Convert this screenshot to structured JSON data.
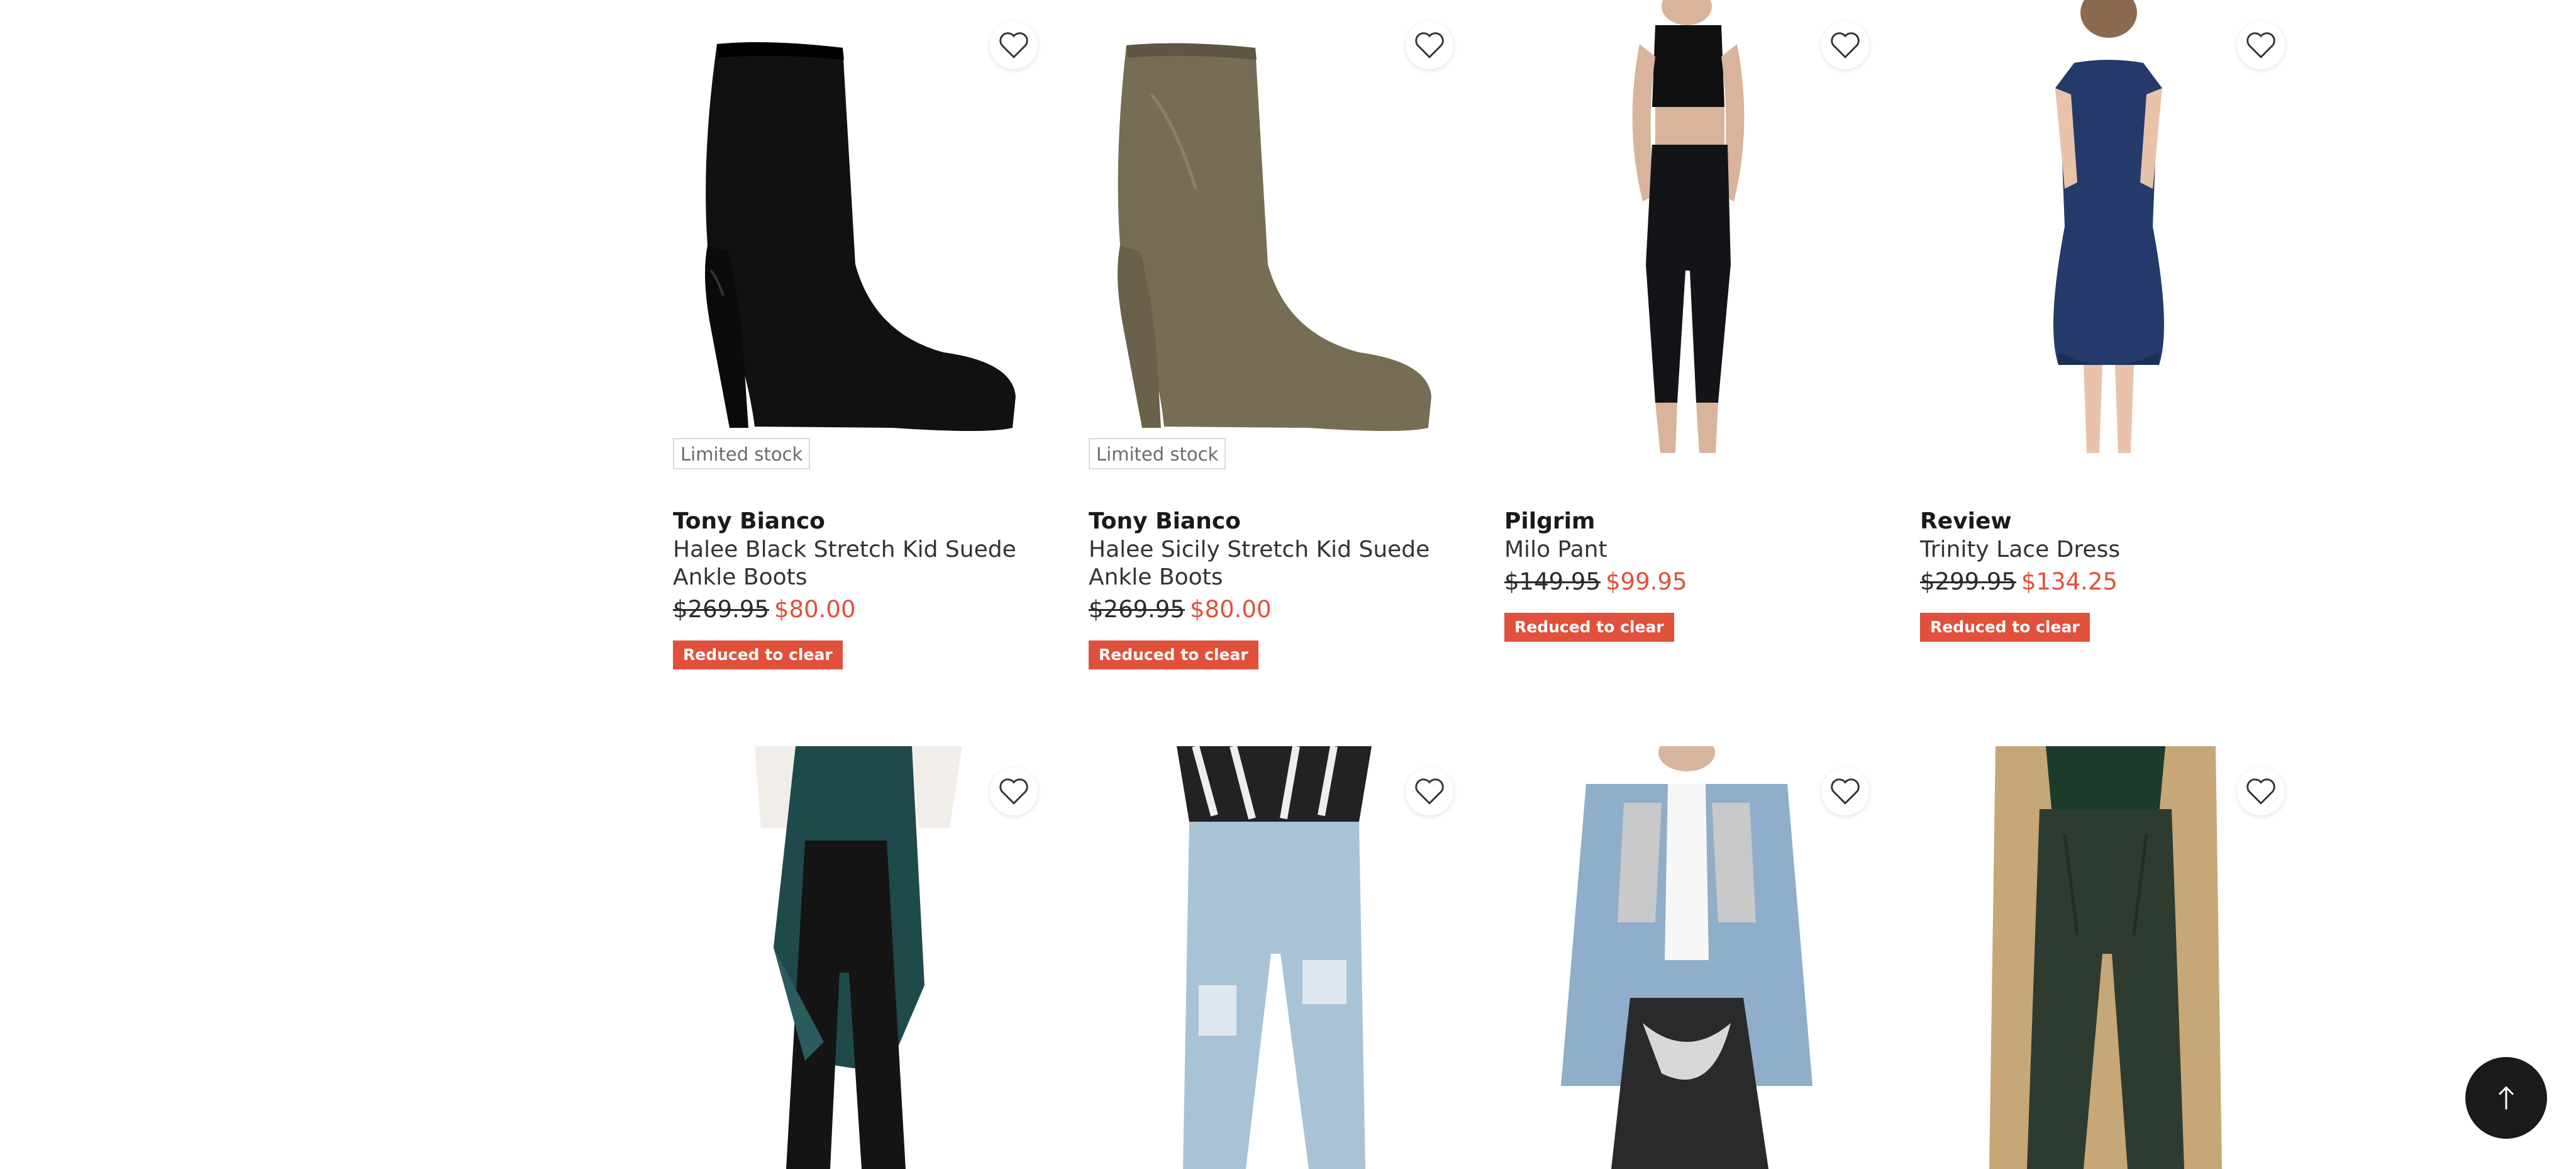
{
  "products": [
    {
      "brand": "Tony Bianco",
      "name": "Halee Black Stretch Kid Suede Ankle Boots",
      "was": "$269.95",
      "now": "$80.00",
      "stock": "Limited stock",
      "promo": "Reduced to clear",
      "image": "black-suede-ankle-boot"
    },
    {
      "brand": "Tony Bianco",
      "name": "Halee Sicily Stretch Kid Suede Ankle Boots",
      "was": "$269.95",
      "now": "$80.00",
      "stock": "Limited stock",
      "promo": "Reduced to clear",
      "image": "olive-suede-ankle-boot"
    },
    {
      "brand": "Pilgrim",
      "name": "Milo Pant",
      "was": "$149.95",
      "now": "$99.95",
      "promo": "Reduced to clear",
      "image": "model-black-pant"
    },
    {
      "brand": "Review",
      "name": "Trinity Lace Dress",
      "was": "$299.95",
      "now": "$134.25",
      "promo": "Reduced to clear",
      "image": "model-navy-lace-dress"
    },
    {
      "image": "model-black-flare-pant"
    },
    {
      "image": "model-distressed-jeans"
    },
    {
      "image": "model-denim-jacket"
    },
    {
      "image": "model-green-leather-pant"
    }
  ],
  "colors": {
    "sale": "#e0503a",
    "badge_border": "#d9d9d9",
    "to_top": "#1a1a1a"
  },
  "icons": {
    "wishlist": "heart-outline-icon",
    "scroll": "arrow-up-icon"
  }
}
